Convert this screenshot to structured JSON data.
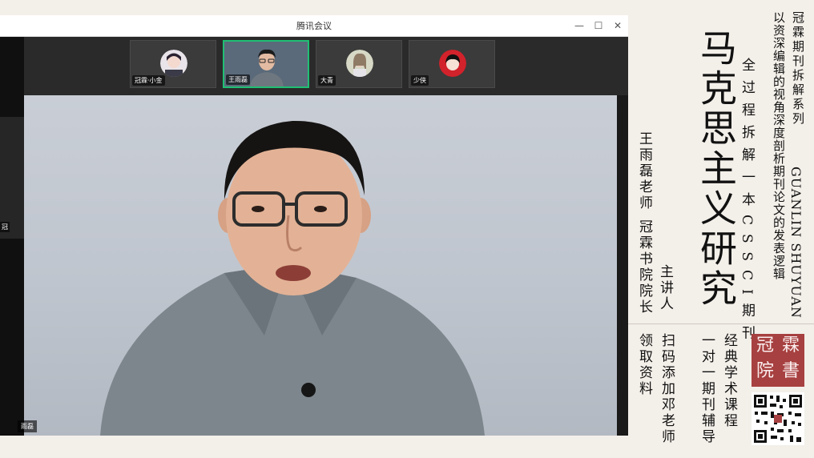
{
  "window": {
    "title": "腾讯会议",
    "minimize": "—",
    "maximize": "☐",
    "close": "✕"
  },
  "participants": [
    {
      "name": "冠霖·小金"
    },
    {
      "name": "王雨磊",
      "active": true
    },
    {
      "name": "大青"
    },
    {
      "name": "少侠"
    }
  ],
  "left_tile_label": "冠",
  "main_corner_label": "雨磊",
  "promo": {
    "series_title": "冠霖期刊拆解系列",
    "series_subtitle": "以资深编辑的视角深度剖析期刊论文的发表逻辑",
    "brand_en": "GUANLIN SHUYUAN",
    "journal": "马克思主义研究",
    "process": "全过程拆解一本CSSCI期刊",
    "speaker_role": "主讲人",
    "speaker_name": "王雨磊老师",
    "speaker_title": "冠霖书院院长",
    "course": "经典学术课程",
    "tutoring": "一对一期刊辅导",
    "scan": "扫码添加邓老师",
    "claim": "领取资料",
    "seal": "冠霖書院"
  },
  "colors": {
    "accent_active": "#1fbf73",
    "seal_red": "#a74040",
    "panel_bg": "#f3efe9"
  }
}
